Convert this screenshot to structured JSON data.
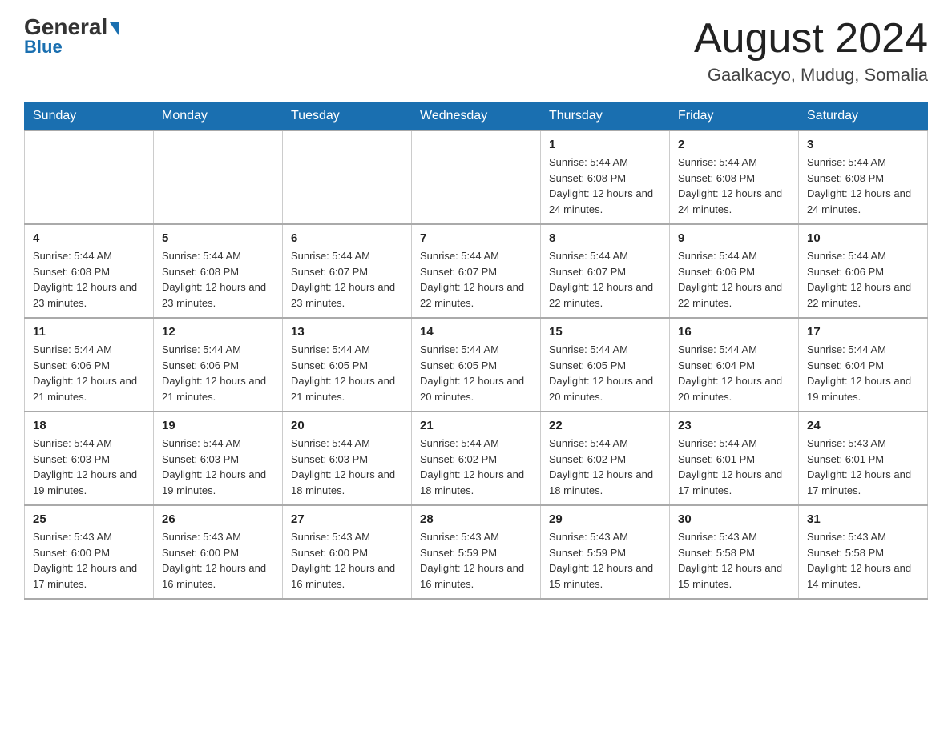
{
  "logo": {
    "general": "General",
    "blue": "Blue",
    "triangle": "▶"
  },
  "header": {
    "month_year": "August 2024",
    "location": "Gaalkacyo, Mudug, Somalia"
  },
  "weekdays": [
    "Sunday",
    "Monday",
    "Tuesday",
    "Wednesday",
    "Thursday",
    "Friday",
    "Saturday"
  ],
  "weeks": [
    [
      {
        "day": "",
        "info": ""
      },
      {
        "day": "",
        "info": ""
      },
      {
        "day": "",
        "info": ""
      },
      {
        "day": "",
        "info": ""
      },
      {
        "day": "1",
        "info": "Sunrise: 5:44 AM\nSunset: 6:08 PM\nDaylight: 12 hours and 24 minutes."
      },
      {
        "day": "2",
        "info": "Sunrise: 5:44 AM\nSunset: 6:08 PM\nDaylight: 12 hours and 24 minutes."
      },
      {
        "day": "3",
        "info": "Sunrise: 5:44 AM\nSunset: 6:08 PM\nDaylight: 12 hours and 24 minutes."
      }
    ],
    [
      {
        "day": "4",
        "info": "Sunrise: 5:44 AM\nSunset: 6:08 PM\nDaylight: 12 hours and 23 minutes."
      },
      {
        "day": "5",
        "info": "Sunrise: 5:44 AM\nSunset: 6:08 PM\nDaylight: 12 hours and 23 minutes."
      },
      {
        "day": "6",
        "info": "Sunrise: 5:44 AM\nSunset: 6:07 PM\nDaylight: 12 hours and 23 minutes."
      },
      {
        "day": "7",
        "info": "Sunrise: 5:44 AM\nSunset: 6:07 PM\nDaylight: 12 hours and 22 minutes."
      },
      {
        "day": "8",
        "info": "Sunrise: 5:44 AM\nSunset: 6:07 PM\nDaylight: 12 hours and 22 minutes."
      },
      {
        "day": "9",
        "info": "Sunrise: 5:44 AM\nSunset: 6:06 PM\nDaylight: 12 hours and 22 minutes."
      },
      {
        "day": "10",
        "info": "Sunrise: 5:44 AM\nSunset: 6:06 PM\nDaylight: 12 hours and 22 minutes."
      }
    ],
    [
      {
        "day": "11",
        "info": "Sunrise: 5:44 AM\nSunset: 6:06 PM\nDaylight: 12 hours and 21 minutes."
      },
      {
        "day": "12",
        "info": "Sunrise: 5:44 AM\nSunset: 6:06 PM\nDaylight: 12 hours and 21 minutes."
      },
      {
        "day": "13",
        "info": "Sunrise: 5:44 AM\nSunset: 6:05 PM\nDaylight: 12 hours and 21 minutes."
      },
      {
        "day": "14",
        "info": "Sunrise: 5:44 AM\nSunset: 6:05 PM\nDaylight: 12 hours and 20 minutes."
      },
      {
        "day": "15",
        "info": "Sunrise: 5:44 AM\nSunset: 6:05 PM\nDaylight: 12 hours and 20 minutes."
      },
      {
        "day": "16",
        "info": "Sunrise: 5:44 AM\nSunset: 6:04 PM\nDaylight: 12 hours and 20 minutes."
      },
      {
        "day": "17",
        "info": "Sunrise: 5:44 AM\nSunset: 6:04 PM\nDaylight: 12 hours and 19 minutes."
      }
    ],
    [
      {
        "day": "18",
        "info": "Sunrise: 5:44 AM\nSunset: 6:03 PM\nDaylight: 12 hours and 19 minutes."
      },
      {
        "day": "19",
        "info": "Sunrise: 5:44 AM\nSunset: 6:03 PM\nDaylight: 12 hours and 19 minutes."
      },
      {
        "day": "20",
        "info": "Sunrise: 5:44 AM\nSunset: 6:03 PM\nDaylight: 12 hours and 18 minutes."
      },
      {
        "day": "21",
        "info": "Sunrise: 5:44 AM\nSunset: 6:02 PM\nDaylight: 12 hours and 18 minutes."
      },
      {
        "day": "22",
        "info": "Sunrise: 5:44 AM\nSunset: 6:02 PM\nDaylight: 12 hours and 18 minutes."
      },
      {
        "day": "23",
        "info": "Sunrise: 5:44 AM\nSunset: 6:01 PM\nDaylight: 12 hours and 17 minutes."
      },
      {
        "day": "24",
        "info": "Sunrise: 5:43 AM\nSunset: 6:01 PM\nDaylight: 12 hours and 17 minutes."
      }
    ],
    [
      {
        "day": "25",
        "info": "Sunrise: 5:43 AM\nSunset: 6:00 PM\nDaylight: 12 hours and 17 minutes."
      },
      {
        "day": "26",
        "info": "Sunrise: 5:43 AM\nSunset: 6:00 PM\nDaylight: 12 hours and 16 minutes."
      },
      {
        "day": "27",
        "info": "Sunrise: 5:43 AM\nSunset: 6:00 PM\nDaylight: 12 hours and 16 minutes."
      },
      {
        "day": "28",
        "info": "Sunrise: 5:43 AM\nSunset: 5:59 PM\nDaylight: 12 hours and 16 minutes."
      },
      {
        "day": "29",
        "info": "Sunrise: 5:43 AM\nSunset: 5:59 PM\nDaylight: 12 hours and 15 minutes."
      },
      {
        "day": "30",
        "info": "Sunrise: 5:43 AM\nSunset: 5:58 PM\nDaylight: 12 hours and 15 minutes."
      },
      {
        "day": "31",
        "info": "Sunrise: 5:43 AM\nSunset: 5:58 PM\nDaylight: 12 hours and 14 minutes."
      }
    ]
  ]
}
